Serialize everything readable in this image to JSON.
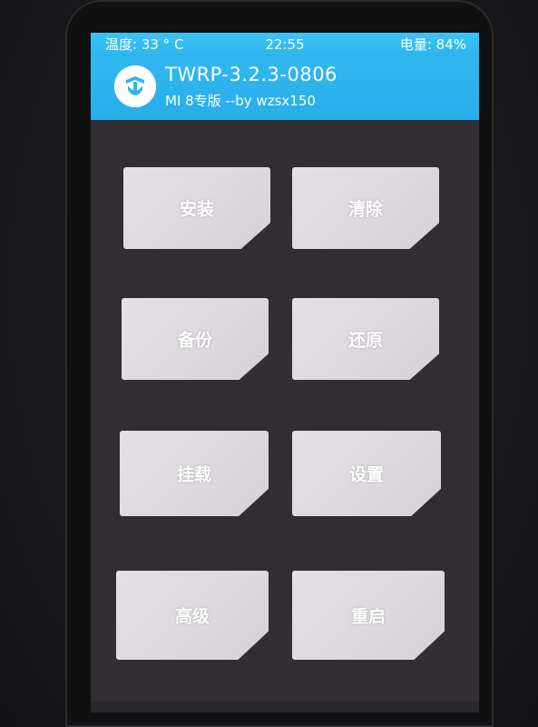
{
  "status_bar": {
    "temperature": "温度: 33 ° C",
    "time": "22:55",
    "battery": "电量: 84%"
  },
  "header": {
    "title": "TWRP-3.2.3-0806",
    "subtitle": "MI 8专版 --by wzsx150",
    "logo_icon": "twrp-logo-icon"
  },
  "menu": {
    "install": "安装",
    "wipe": "清除",
    "backup": "备份",
    "restore": "还原",
    "mount": "挂载",
    "settings": "设置",
    "advanced": "高级",
    "reboot": "重启"
  },
  "colors": {
    "accent": "#2eb5ef",
    "button": "#dcd8dc",
    "background": "#302e33"
  }
}
